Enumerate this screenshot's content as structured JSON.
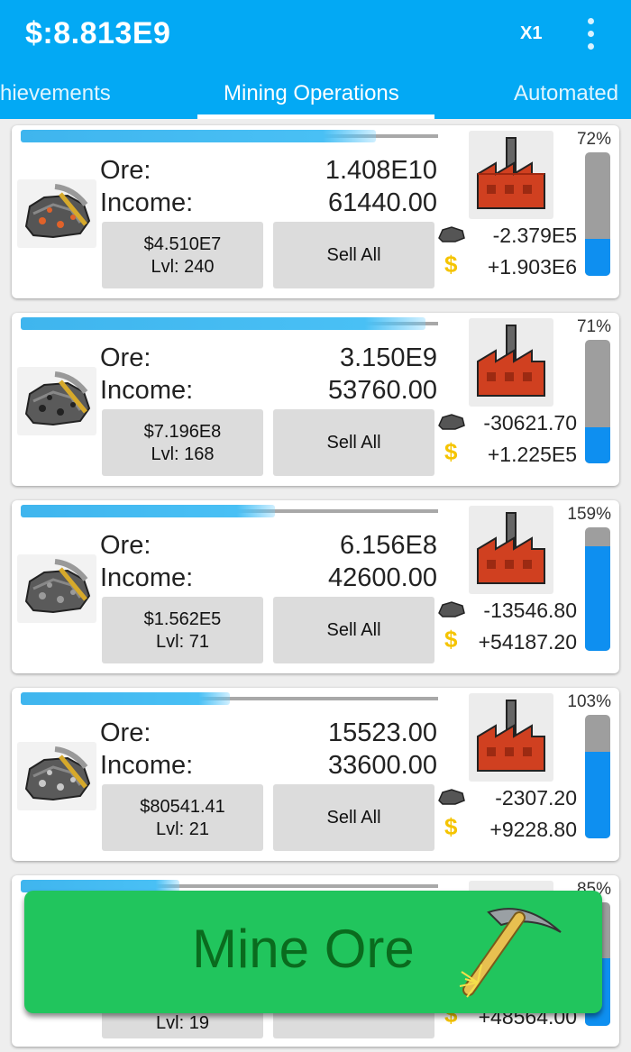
{
  "header": {
    "money": "$:8.813E9",
    "multiplier": "X1",
    "menu_icon": "overflow-menu-icon",
    "color": "#03a9f4"
  },
  "tabs": [
    {
      "label": "hievements"
    },
    {
      "label": "Mining Operations",
      "active": true
    },
    {
      "label": "Automated"
    }
  ],
  "cards": [
    {
      "ore_label": "Ore:",
      "ore_value": "1.408E10",
      "income_label": "Income:",
      "income_value": "61440.00",
      "upgrade_price": "$4.510E7",
      "level": "Lvl: 240",
      "sell_label": "Sell All",
      "ore_flow": "-2.379E5",
      "cash_flow": "+1.903E6",
      "dollar_symbol": "$",
      "percent": "72%",
      "gauge_level": 0.3,
      "progress": 0.85
    },
    {
      "ore_label": "Ore:",
      "ore_value": "3.150E9",
      "income_label": "Income:",
      "income_value": "53760.00",
      "upgrade_price": "$7.196E8",
      "level": "Lvl: 168",
      "sell_label": "Sell All",
      "ore_flow": "-30621.70",
      "cash_flow": "+1.225E5",
      "dollar_symbol": "$",
      "percent": "71%",
      "gauge_level": 0.29,
      "progress": 0.97
    },
    {
      "ore_label": "Ore:",
      "ore_value": "6.156E8",
      "income_label": "Income:",
      "income_value": "42600.00",
      "upgrade_price": "$1.562E5",
      "level": "Lvl: 71",
      "sell_label": "Sell All",
      "ore_flow": "-13546.80",
      "cash_flow": "+54187.20",
      "dollar_symbol": "$",
      "percent": "159%",
      "gauge_level": 0.85,
      "progress": 0.61
    },
    {
      "ore_label": "Ore:",
      "ore_value": "15523.00",
      "income_label": "Income:",
      "income_value": "33600.00",
      "upgrade_price": "$80541.41",
      "level": "Lvl: 21",
      "sell_label": "Sell All",
      "ore_flow": "-2307.20",
      "cash_flow": "+9228.80",
      "dollar_symbol": "$",
      "percent": "103%",
      "gauge_level": 0.7,
      "progress": 0.5
    },
    {
      "level": "Lvl: 19",
      "cash_flow": "+48564.00",
      "dollar_symbol": "$",
      "percent": "85%",
      "gauge_level": 0.55,
      "progress": 0.38
    }
  ],
  "mine_button": {
    "label": "Mine Ore",
    "icon": "pickaxe-icon",
    "color": "#21c55d"
  }
}
